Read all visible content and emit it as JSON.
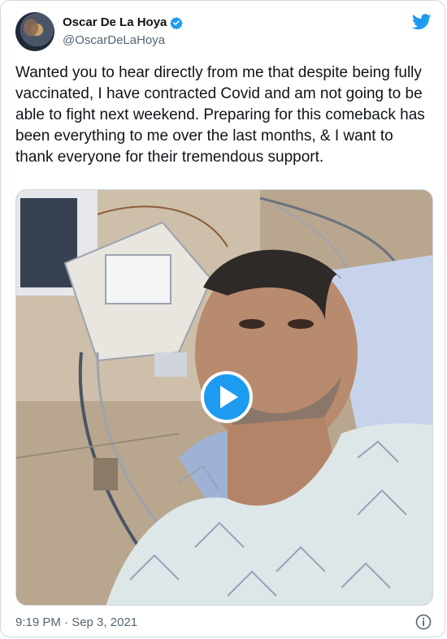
{
  "tweet": {
    "display_name": "Oscar De La Hoya",
    "handle": "@OscarDeLaHoya",
    "text": "Wanted you to hear directly from me that despite being fully vaccinated, I have contracted Covid and am not going to be able to fight next weekend. Preparing for this comeback has been everything to me over the last months, & I want to thank everyone for their tremendous support.",
    "timestamp": "9:19 PM · Sep 3, 2021"
  },
  "icons": {
    "verified": "verified-badge-icon",
    "twitter": "twitter-bird-icon",
    "play": "play-icon",
    "info": "info-icon"
  },
  "colors": {
    "accent": "#1d9bf0",
    "text": "#0f1419",
    "muted": "#536471",
    "border": "#cfd9de"
  }
}
